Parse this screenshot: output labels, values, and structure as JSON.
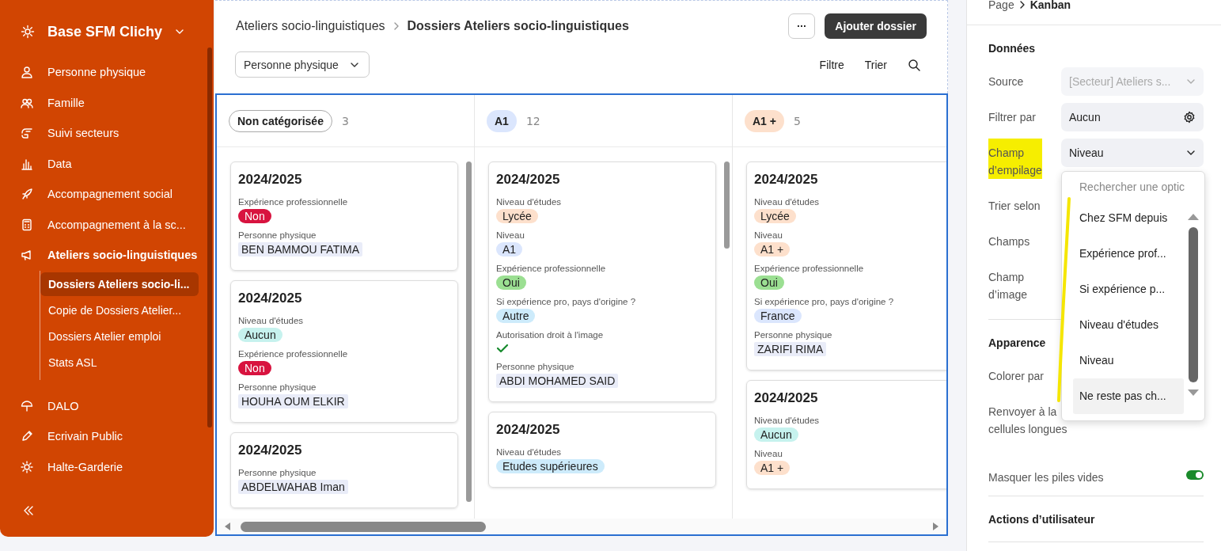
{
  "sidebar": {
    "workspace": "Base SFM Clichy",
    "items": [
      {
        "label": "Personne physique",
        "selected": false
      },
      {
        "label": "Famille",
        "selected": false
      },
      {
        "label": "Suivi secteurs",
        "selected": false
      },
      {
        "label": "Data",
        "selected": false
      },
      {
        "label": "Accompagnement social",
        "selected": false
      },
      {
        "label": "Accompagnement à la sc...",
        "selected": false
      },
      {
        "label": "Ateliers socio-linguistiques",
        "selected": true,
        "children": [
          {
            "label": "Dossiers Ateliers socio-li...",
            "selected": true
          },
          {
            "label": "Copie de Dossiers Atelier...",
            "selected": false
          },
          {
            "label": "Dossiers Atelier emploi",
            "selected": false
          },
          {
            "label": "Stats ASL",
            "selected": false
          }
        ]
      },
      {
        "label": "DALO",
        "selected": false
      },
      {
        "label": "Ecrivain Public",
        "selected": false
      },
      {
        "label": "Halte-Garderie",
        "selected": false
      }
    ]
  },
  "header": {
    "breadcrumb": [
      "Ateliers socio-linguistiques",
      "Dossiers Ateliers socio-linguistiques"
    ],
    "more_button": "···",
    "add_button": "Ajouter dossier",
    "view_select": "Personne physique",
    "filter": "Filtre",
    "sort": "Trier"
  },
  "board": {
    "stacks": [
      {
        "title": "Non catégorisée",
        "count": "3",
        "color": "#ffffff",
        "cards": [
          {
            "title": "2024/2025",
            "fields": [
              {
                "label": "Expérience professionnelle",
                "kind": "tag",
                "value": "Non",
                "color": "#d8133f"
              },
              {
                "label": "Personne physique",
                "kind": "link",
                "value": "BEN BAMMOU FATIMA"
              }
            ]
          },
          {
            "title": "2024/2025",
            "fields": [
              {
                "label": "Niveau d'études",
                "kind": "tag",
                "value": "Aucun",
                "color": "#c6f2ee"
              },
              {
                "label": "Expérience professionnelle",
                "kind": "tag",
                "value": "Non",
                "color": "#d8133f"
              },
              {
                "label": "Personne physique",
                "kind": "link",
                "value": "HOUHA OUM ELKIR"
              }
            ]
          },
          {
            "title": "2024/2025",
            "fields": [
              {
                "label": "Personne physique",
                "kind": "link",
                "value": "ABDELWAHAB Iman"
              }
            ]
          }
        ]
      },
      {
        "title": "A1",
        "count": "12",
        "color": "#dbe6fd",
        "cards": [
          {
            "title": "2024/2025",
            "fields": [
              {
                "label": "Niveau d'études",
                "kind": "tag",
                "value": "Lycée",
                "color": "#fde0cc"
              },
              {
                "label": "Niveau",
                "kind": "tag",
                "value": "A1",
                "color": "#dbe6fd"
              },
              {
                "label": "Expérience professionnelle",
                "kind": "tag",
                "value": "Oui",
                "color": "#9bdf92"
              },
              {
                "label": "Si expérience pro, pays d'origine ?",
                "kind": "tag",
                "value": "Autre",
                "color": "#cdebfb"
              },
              {
                "label": "Autorisation droit à l'image",
                "kind": "check",
                "checked": true
              },
              {
                "label": "Personne physique",
                "kind": "link",
                "value": "ABDI MOHAMED SAID"
              }
            ]
          },
          {
            "title": "2024/2025",
            "fields": [
              {
                "label": "Niveau d'études",
                "kind": "tag",
                "value": "Etudes supérieures",
                "color": "#cdebfb"
              }
            ]
          }
        ]
      },
      {
        "title": "A1 +",
        "count": "5",
        "color": "#fde0cc",
        "cards": [
          {
            "title": "2024/2025",
            "fields": [
              {
                "label": "Niveau d'études",
                "kind": "tag",
                "value": "Lycée",
                "color": "#fde0cc"
              },
              {
                "label": "Niveau",
                "kind": "tag",
                "value": "A1 +",
                "color": "#fde0cc"
              },
              {
                "label": "Expérience professionnelle",
                "kind": "tag",
                "value": "Oui",
                "color": "#9bdf92"
              },
              {
                "label": "Si expérience pro, pays d'origine ?",
                "kind": "tag",
                "value": "France",
                "color": "#dbe6fd"
              },
              {
                "label": "Personne physique",
                "kind": "link",
                "value": "ZARIFI RIMA"
              }
            ]
          },
          {
            "title": "2024/2025",
            "fields": [
              {
                "label": "Niveau d'études",
                "kind": "tag",
                "value": "Aucun",
                "color": "#c6f2ee"
              },
              {
                "label": "Niveau",
                "kind": "tag",
                "value": "A1 +",
                "color": "#fde0cc"
              }
            ]
          }
        ]
      }
    ]
  },
  "panel": {
    "breadcrumb": [
      "Page",
      "Kanban"
    ],
    "sections": [
      {
        "title": "Données",
        "rows": [
          {
            "label": [
              "Source"
            ],
            "kind": "select",
            "value": "[Secteur] Ateliers s...",
            "disabled": true,
            "highlighted": false
          },
          {
            "label": [
              "Filtrer par"
            ],
            "kind": "gear",
            "value": "Aucun",
            "disabled": false,
            "highlighted": false
          },
          {
            "label": [
              "Champ",
              "d’empilage"
            ],
            "kind": "select",
            "value": "Niveau",
            "disabled": false,
            "highlighted": true
          },
          {
            "label": [
              "Trier selon"
            ],
            "kind": "hidden",
            "highlighted": false
          },
          {
            "label": [
              "Champs"
            ],
            "kind": "hidden",
            "highlighted": false
          },
          {
            "label": [
              "Champ",
              "d’image"
            ],
            "kind": "hidden",
            "highlighted": false
          }
        ]
      },
      {
        "title": "Apparence",
        "rows": [
          {
            "label": [
              "Colorer par"
            ],
            "kind": "hidden",
            "highlighted": false
          },
          {
            "label": [
              "Renvoyer à la",
              "cellules longues"
            ],
            "kind": "hidden",
            "highlighted": false
          },
          {
            "label": [
              "Masquer les piles vides"
            ],
            "kind": "toggle",
            "on": true,
            "highlighted": false
          }
        ]
      },
      {
        "title": "Actions d’utilisateur"
      }
    ]
  },
  "dropdown": {
    "placeholder": "Rechercher une optic",
    "options": [
      {
        "label": "Chez SFM depuis",
        "highlighted": false
      },
      {
        "label": "Expérience prof...",
        "highlighted": false
      },
      {
        "label": "Si expérience p...",
        "highlighted": false
      },
      {
        "label": "Niveau d'études",
        "highlighted": false
      },
      {
        "label": "Niveau",
        "highlighted": false
      },
      {
        "label": "Ne reste pas ch...",
        "highlighted": true
      }
    ]
  },
  "marker_stroke": {
    "kind": "freehand"
  }
}
